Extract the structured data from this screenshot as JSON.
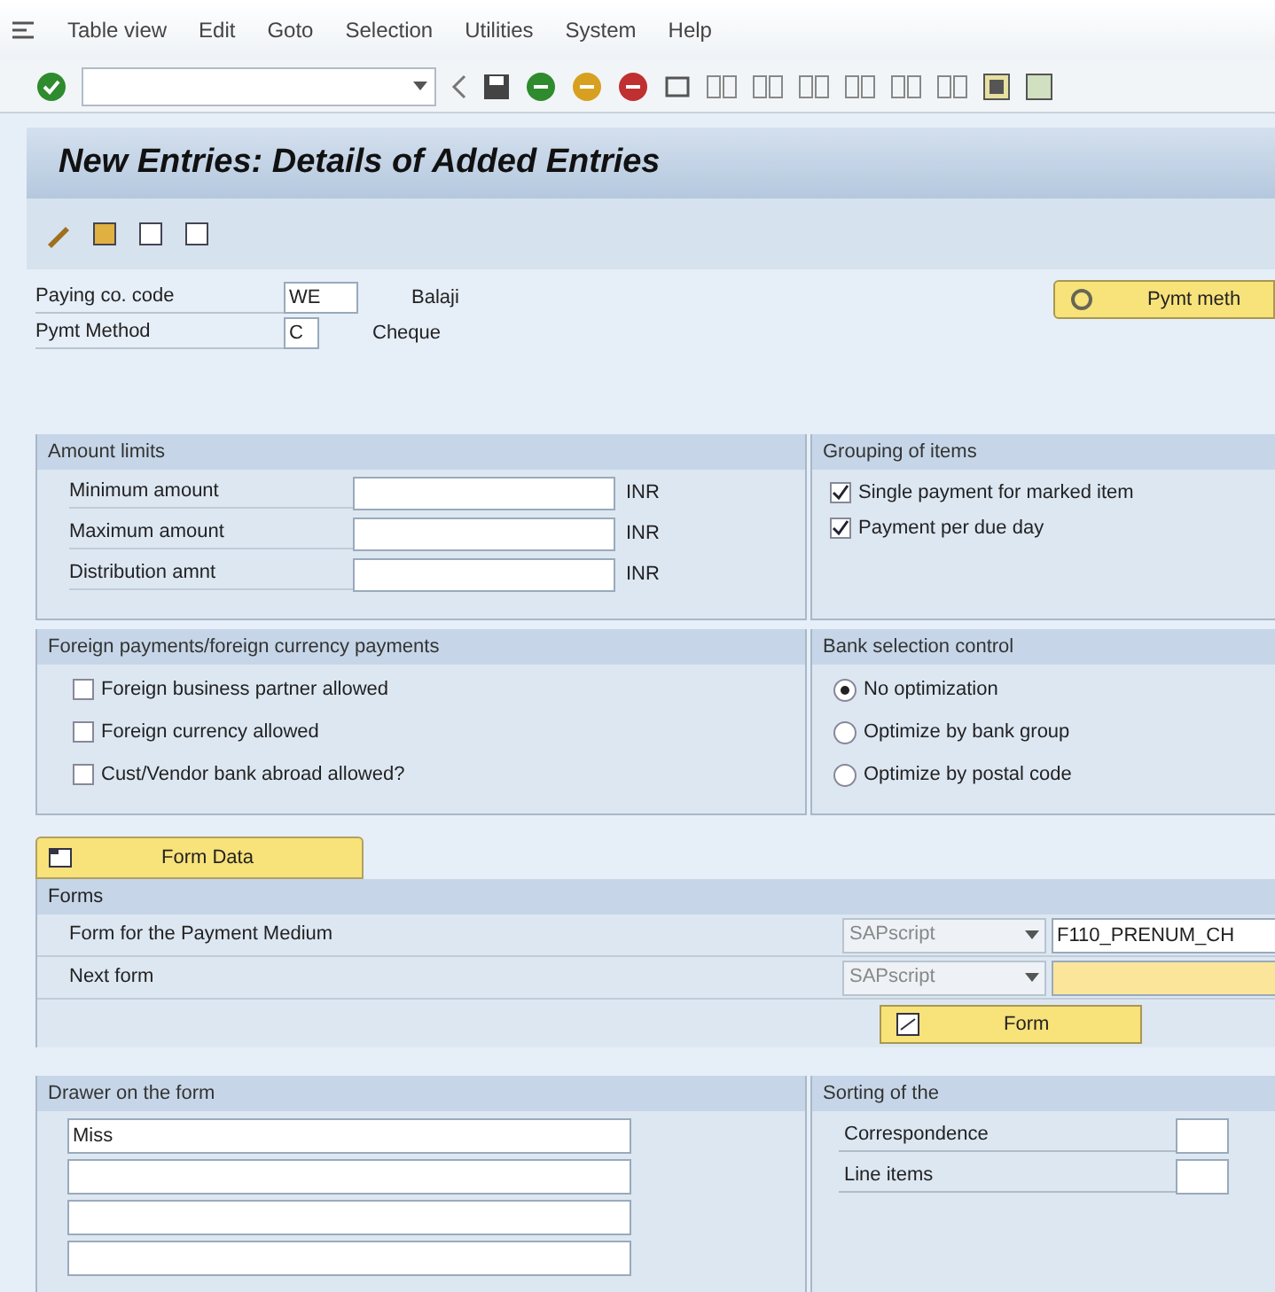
{
  "menu": [
    "Table view",
    "Edit",
    "Goto",
    "Selection",
    "Utilities",
    "System",
    "Help"
  ],
  "title": "New Entries: Details of Added Entries",
  "header": {
    "fields": [
      {
        "label": "Paying co. code",
        "value": "WE",
        "text": "Balaji"
      },
      {
        "label": "Pymt Method",
        "value": "C",
        "text": "Cheque"
      }
    ],
    "button": "Pymt meth"
  },
  "amount_limits": {
    "title": "Amount limits",
    "rows": [
      {
        "label": "Minimum amount",
        "currency": "INR"
      },
      {
        "label": "Maximum amount",
        "currency": "INR"
      },
      {
        "label": "Distribution amnt",
        "currency": "INR"
      }
    ]
  },
  "grouping_of_items": {
    "title": "Grouping of items",
    "options": [
      {
        "label": "Single payment for marked item",
        "checked": true
      },
      {
        "label": "Payment per due day",
        "checked": true
      }
    ]
  },
  "foreign_payments": {
    "title": "Foreign payments/foreign currency payments",
    "options": [
      {
        "label": "Foreign business partner allowed",
        "checked": false
      },
      {
        "label": "Foreign currency allowed",
        "checked": false
      },
      {
        "label": "Cust/Vendor bank abroad allowed?",
        "checked": false
      }
    ]
  },
  "bank_selection": {
    "title": "Bank selection control",
    "options": [
      {
        "label": "No optimization",
        "selected": true
      },
      {
        "label": "Optimize by bank group",
        "selected": false
      },
      {
        "label": "Optimize by postal code",
        "selected": false
      }
    ]
  },
  "form_data_tab": "Form Data",
  "forms": {
    "title": "Forms",
    "rows": [
      {
        "label": "Form for the Payment Medium",
        "type": "SAPscript",
        "value": "F110_PRENUM_CH"
      },
      {
        "label": "Next form",
        "type": "SAPscript"
      }
    ],
    "button": "Form"
  },
  "drawer": {
    "title": "Drawer on the form",
    "first_line": "Miss"
  },
  "sorting": {
    "title": "Sorting of the",
    "rows": [
      {
        "label": "Correspondence"
      },
      {
        "label": "Line items"
      }
    ]
  }
}
